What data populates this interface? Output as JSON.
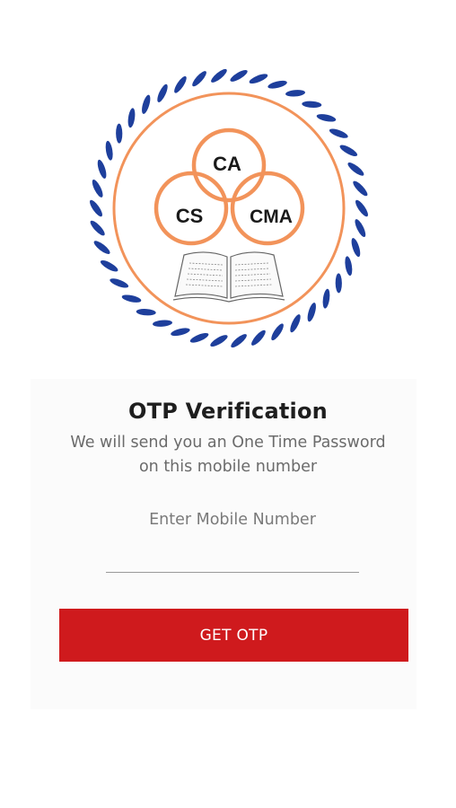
{
  "logo": {
    "circle_labels": [
      "CA",
      "CS",
      "CMA"
    ],
    "colors": {
      "rope": "#1e3f9c",
      "ring": "#f2935a",
      "text": "#1a1a1a"
    }
  },
  "verification": {
    "title": "OTP Verification",
    "subtitle_line1": "We will send you an One Time Password",
    "subtitle_line2": "on this mobile number",
    "mobile_placeholder": "Enter Mobile Number",
    "button_label": "GET OTP"
  },
  "colors": {
    "button": "#cf1a1d"
  }
}
